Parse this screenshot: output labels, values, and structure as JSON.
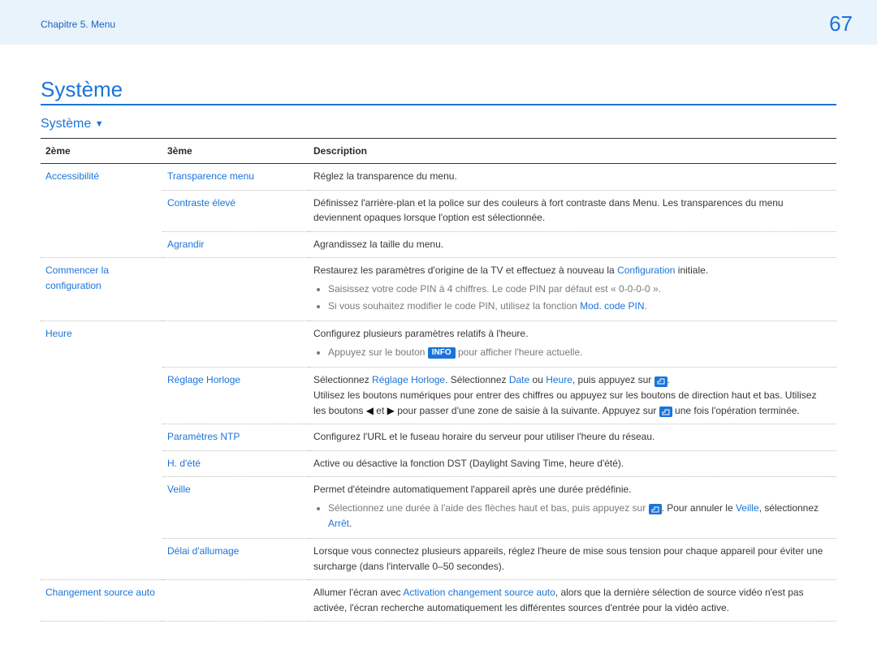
{
  "header": {
    "breadcrumb": "Chapitre 5. Menu",
    "page_number": "67"
  },
  "title": "Système",
  "subtitle": "Système",
  "table": {
    "headers": {
      "c1": "2ème",
      "c2": "3ème",
      "c3": "Description"
    },
    "rows": {
      "acc": {
        "l1": "Accessibilité",
        "transp_label": "Transparence menu",
        "transp_desc": "Réglez la transparence du menu.",
        "contrast_label": "Contraste élevé",
        "contrast_desc": "Définissez l'arrière-plan et la police sur des couleurs à fort contraste dans Menu. Les transparences du menu deviennent opaques lorsque l'option est sélectionnée.",
        "enlarge_label": "Agrandir",
        "enlarge_desc": "Agrandissez la taille du menu."
      },
      "start": {
        "l1": "Commencer la configuration",
        "desc_prefix": "Restaurez les paramètres d'origine de la TV et effectuez à nouveau la ",
        "desc_link": "Configuration",
        "desc_suffix": " initiale.",
        "bullet1": "Saisissez votre code PIN à 4 chiffres. Le code PIN par défaut est « 0-0-0-0 ».",
        "bullet2a": "Si vous souhaitez modifier le code PIN, utilisez la fonction ",
        "bullet2b": "Mod. code PIN",
        "bullet2c": "."
      },
      "heure": {
        "l1": "Heure",
        "desc": "Configurez plusieurs paramètres relatifs à l'heure.",
        "bullet_a": "Appuyez sur le bouton ",
        "info_pill": "INFO",
        "bullet_b": " pour afficher l'heure actuelle.",
        "clock_label": "Réglage Horloge",
        "clock_a": "Sélectionnez ",
        "clock_link1": "Réglage Horloge",
        "clock_b": ". Sélectionnez ",
        "clock_link2": "Date",
        "clock_c": " ou ",
        "clock_link3": "Heure",
        "clock_d": ", puis appuyez sur ",
        "clock_e": ".",
        "clock_line2a": "Utilisez les boutons numériques pour entrer des chiffres ou appuyez sur les boutons de direction haut et bas. Utilisez les boutons ",
        "clock_line2b": " et ",
        "clock_line2c": " pour passer d'une zone de saisie à la suivante. Appuyez sur ",
        "clock_line2d": " une fois l'opération terminée.",
        "ntp_label": "Paramètres NTP",
        "ntp_desc": "Configurez l'URL et le fuseau horaire du serveur pour utiliser l'heure du réseau.",
        "dst_label": "H. d'été",
        "dst_desc": "Active ou désactive la fonction DST (Daylight Saving Time, heure d'été).",
        "sleep_label": "Veille",
        "sleep_desc": "Permet d'éteindre automatiquement l'appareil après une durée prédéfinie.",
        "sleep_b1a": "Sélectionnez une durée à l'aide des flèches haut et bas, puis appuyez sur ",
        "sleep_b1b": ". Pour annuler le ",
        "sleep_link1": "Veille",
        "sleep_b1c": ", sélectionnez ",
        "sleep_link2": "Arrêt",
        "sleep_b1d": ".",
        "delay_label": "Délai d'allumage",
        "delay_desc": "Lorsque vous connectez plusieurs appareils, réglez l'heure de mise sous tension pour chaque appareil pour éviter une surcharge (dans l'intervalle 0–50 secondes)."
      },
      "autosrc": {
        "l1": "Changement source auto",
        "desc_a": "Allumer l'écran avec ",
        "desc_link": "Activation changement source auto",
        "desc_b": ", alors que la dernière sélection de source vidéo n'est pas activée, l'écran recherche automatiquement les différentes sources d'entrée pour la vidéo active."
      }
    }
  }
}
